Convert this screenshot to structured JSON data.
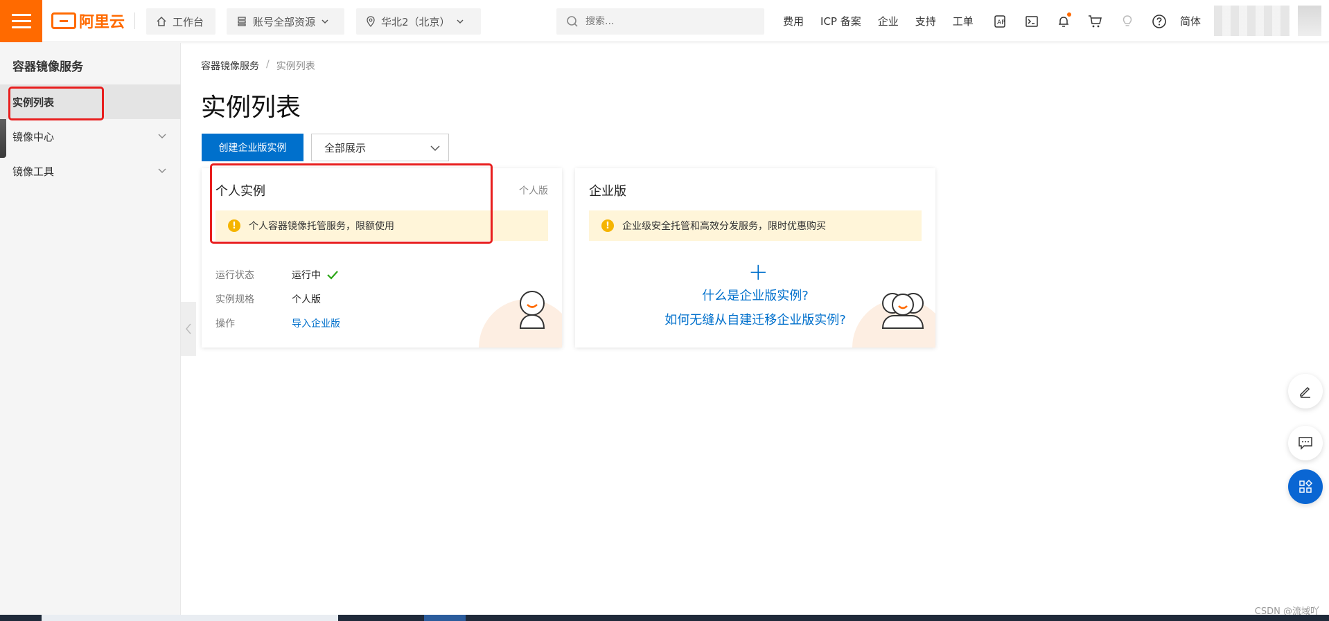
{
  "topbar": {
    "brand": "阿里云",
    "workbench": "工作台",
    "resource_scope": "账号全部资源",
    "region": "华北2（北京）",
    "search_placeholder": "搜索...",
    "links": [
      "费用",
      "ICP 备案",
      "企业",
      "支持",
      "工单"
    ],
    "language": "简体"
  },
  "sidebar": {
    "title": "容器镜像服务",
    "items": [
      {
        "label": "实例列表",
        "active": true
      },
      {
        "label": "镜像中心",
        "active": false
      },
      {
        "label": "镜像工具",
        "active": false
      }
    ]
  },
  "breadcrumb": {
    "root": "容器镜像服务",
    "separator": "/",
    "current": "实例列表"
  },
  "page": {
    "title": "实例列表",
    "create_button": "创建企业版实例",
    "filter": "全部展示"
  },
  "personal_card": {
    "title": "个人实例",
    "tag": "个人版",
    "notice": "个人容器镜像托管服务，限额使用",
    "rows": [
      {
        "key": "运行状态",
        "value": "运行中"
      },
      {
        "key": "实例规格",
        "value": "个人版"
      },
      {
        "key": "操作",
        "value": "导入企业版"
      }
    ]
  },
  "enterprise_card": {
    "title": "企业版",
    "notice": "企业级安全托管和高效分发服务，限时优惠购买",
    "plus": "+",
    "link1": "什么是企业版实例?",
    "link2": "如何无缝从自建迁移企业版实例?"
  },
  "watermark": "CSDN @流域吖",
  "colors": {
    "accent": "#ff6a00",
    "primary": "#0070cc",
    "notice_bg": "#fff5d9",
    "success": "#2aa515",
    "annotation": "#e81e1e"
  }
}
